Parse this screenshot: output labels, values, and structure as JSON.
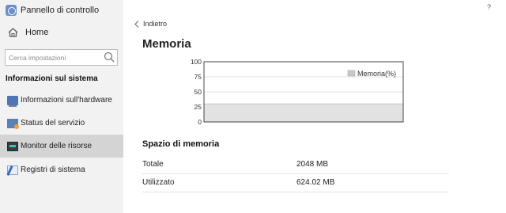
{
  "window": {
    "app_title": "Pannello di controllo",
    "help_label": "?"
  },
  "sidebar": {
    "home_label": "Home",
    "search_placeholder": "Cerca impostazioni",
    "section_title": "Informazioni sul sistema",
    "items": [
      {
        "label": "Informazioni sull'hardware",
        "icon": "hardware-icon",
        "active": false
      },
      {
        "label": "Status del servizio",
        "icon": "service-icon",
        "active": false
      },
      {
        "label": "Monitor delle risorse",
        "icon": "monitor-icon",
        "active": true
      },
      {
        "label": "Registri di sistema",
        "icon": "log-icon",
        "active": false
      }
    ]
  },
  "main": {
    "back_label": "Indietro",
    "title": "Memoria",
    "storage_section_title": "Spazio di memoria",
    "rows": [
      {
        "label": "Totale",
        "value": "2048 MB"
      },
      {
        "label": "Utilizzato",
        "value": "624.02 MB"
      }
    ]
  },
  "chart_data": {
    "type": "area",
    "ylim": [
      0,
      100
    ],
    "yticks": [
      "100",
      "75",
      "50",
      "25",
      "0"
    ],
    "series": [
      {
        "name": "Memoria(%)",
        "values": [
          30,
          30
        ],
        "color": "#e2e2e2"
      }
    ],
    "legend_position": "top-right",
    "grid": true
  },
  "colors": {
    "sidebar_bg": "#f2f2f2",
    "active_item_bg": "#d4d4d4",
    "area_fill": "#e2e2e2"
  }
}
